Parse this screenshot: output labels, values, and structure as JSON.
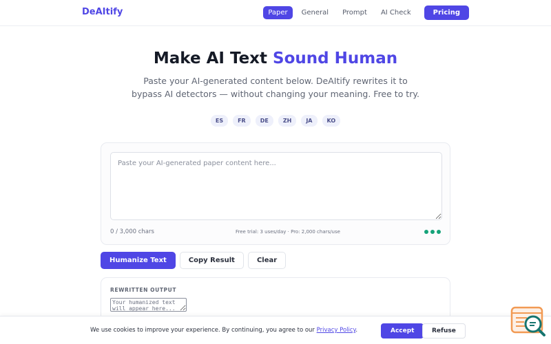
{
  "header": {
    "logo": "DeAItify",
    "nav": [
      {
        "label": "Paper",
        "active": true
      },
      {
        "label": "General",
        "active": false
      },
      {
        "label": "Prompt",
        "active": false
      },
      {
        "label": "AI Check",
        "active": false
      }
    ],
    "pricing_label": "Pricing"
  },
  "hero": {
    "title_main": "Make AI Text ",
    "title_accent": "Sound Human",
    "subtitle": "Paste your AI-generated content below. DeAItify rewrites it to bypass AI detectors — without changing your meaning. Free to try."
  },
  "languages": [
    "ES",
    "FR",
    "DE",
    "ZH",
    "JA",
    "KO"
  ],
  "input": {
    "placeholder": "Paste your AI-generated paper content here...",
    "value": "",
    "char_count": "0 / 3,000 chars",
    "trial_note": "Free trial: 3 uses/day · Pro: 2,000 chars/use"
  },
  "actions": {
    "humanize_label": "Humanize Text",
    "copy_label": "Copy Result",
    "clear_label": "Clear"
  },
  "output": {
    "label": "REWRITTEN OUTPUT",
    "placeholder": "Your humanized text will appear here..."
  },
  "cookie": {
    "text": "We use cookies to improve your experience. By continuing, you agree to our ",
    "link_label": "Privacy Policy",
    "suffix": ".",
    "accept_label": "Accept",
    "refuse_label": "Refuse"
  },
  "colors": {
    "brand": "#4f46e5",
    "status_dot": "#16a37a",
    "widget_orange": "#f29a53",
    "widget_teal": "#16756f"
  },
  "icons": {
    "widget": "chat-search-icon"
  }
}
